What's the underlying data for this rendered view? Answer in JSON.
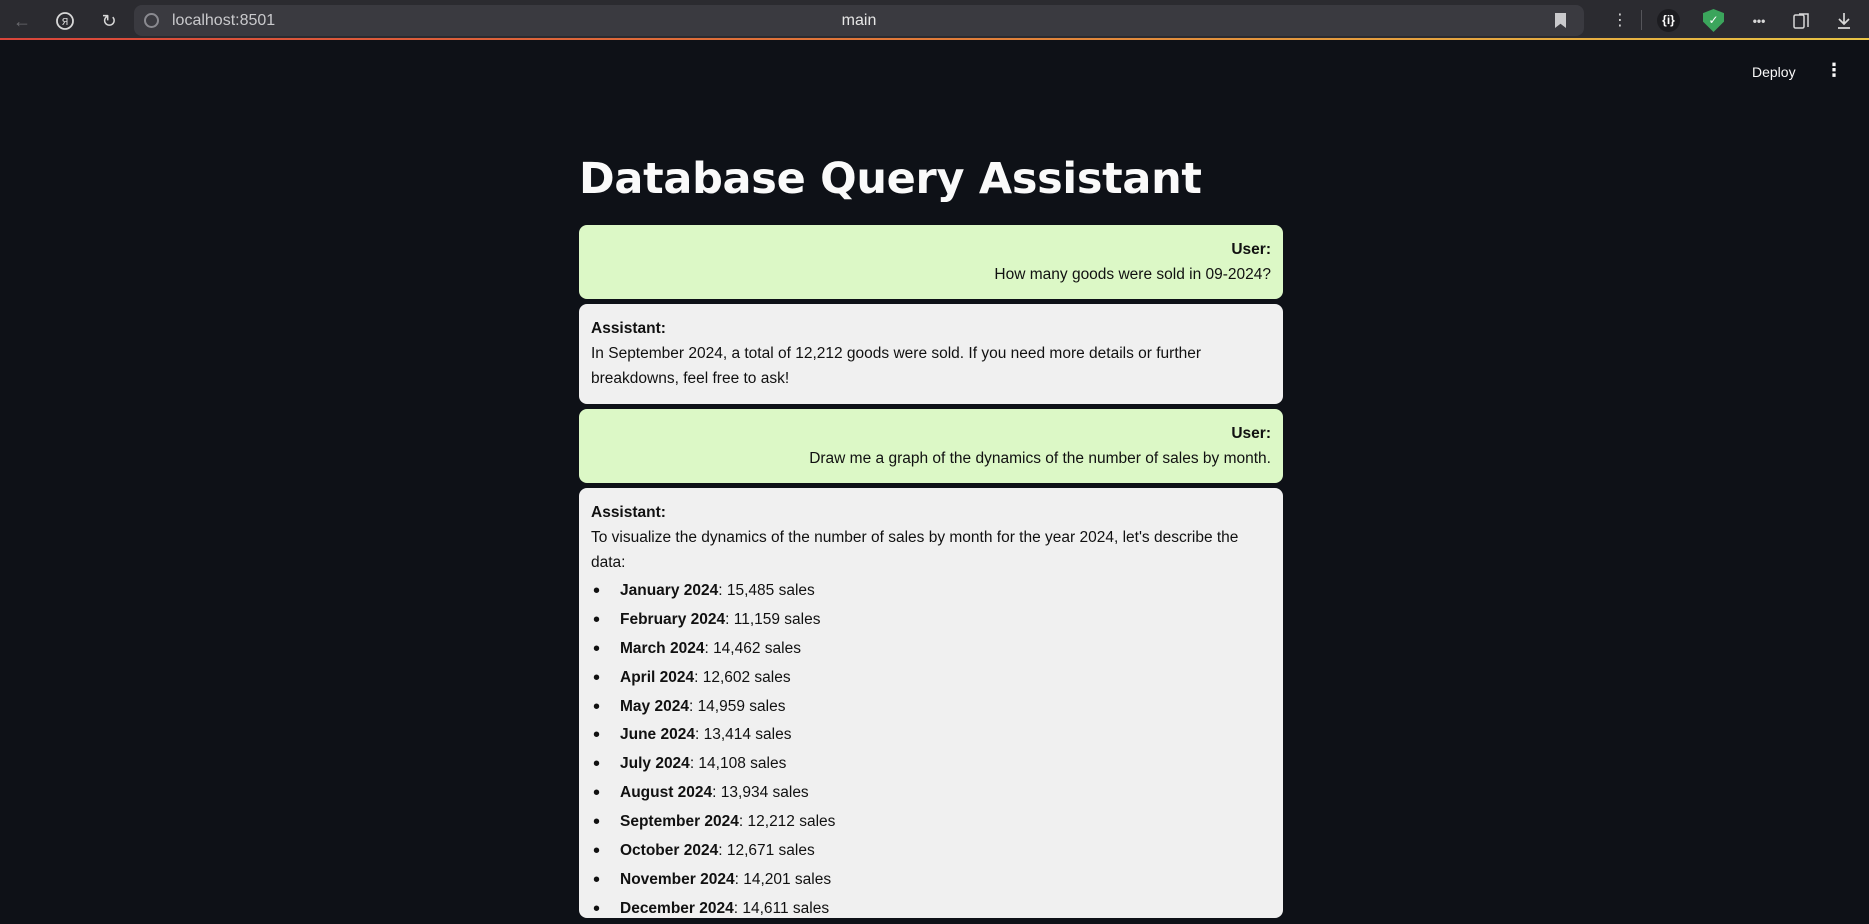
{
  "browser": {
    "url": "localhost:8501",
    "tab_title": "main",
    "json_ext_label": "{i}",
    "overflow_label": "•••"
  },
  "app": {
    "deploy_label": "Deploy",
    "menu_glyph": "⋮",
    "title": "Database Query Assistant"
  },
  "chat": {
    "messages": [
      {
        "role": "User:",
        "text": "How many goods were sold in 09-2024?"
      },
      {
        "role": "Assistant:",
        "text": "In September 2024, a total of 12,212 goods were sold. If you need more details or further breakdowns, feel free to ask!"
      },
      {
        "role": "User:",
        "text": "Draw me a graph of the dynamics of the number of sales by month."
      },
      {
        "role": "Assistant:",
        "text": "To visualize the dynamics of the number of sales by month for the year 2024, let's describe the data:",
        "items": [
          {
            "month": "January 2024",
            "value": ": 15,485 sales"
          },
          {
            "month": "February 2024",
            "value": ": 11,159 sales"
          },
          {
            "month": "March 2024",
            "value": ": 14,462 sales"
          },
          {
            "month": "April 2024",
            "value": ": 12,602 sales"
          },
          {
            "month": "May 2024",
            "value": ": 14,959 sales"
          },
          {
            "month": "June 2024",
            "value": ": 13,414 sales"
          },
          {
            "month": "July 2024",
            "value": ": 14,108 sales"
          },
          {
            "month": "August 2024",
            "value": ": 13,934 sales"
          },
          {
            "month": "September 2024",
            "value": ": 12,212 sales"
          },
          {
            "month": "October 2024",
            "value": ": 12,671 sales"
          },
          {
            "month": "November 2024",
            "value": ": 14,201 sales"
          },
          {
            "month": "December 2024",
            "value": ": 14,611 sales"
          }
        ]
      }
    ]
  }
}
